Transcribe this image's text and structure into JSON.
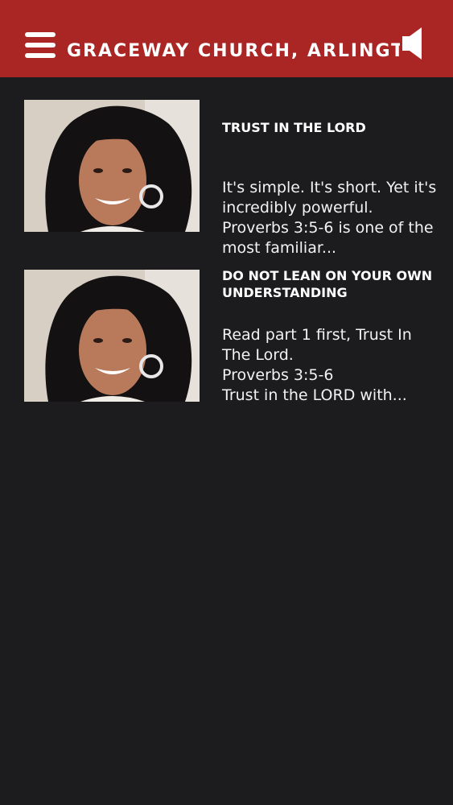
{
  "header": {
    "title": "GRACEWAY CHURCH, ARLINGTON",
    "menu_icon": "hamburger-menu-icon",
    "audio_icon": "speaker-icon",
    "accent_color": "#aa2624"
  },
  "background_color": "#1c1b1d",
  "posts": [
    {
      "title": "TRUST IN THE LORD",
      "excerpt": "It's simple. It's short. Yet it's incredibly powerful. Proverbs 3:5-6 is one of the most familiar..."
    },
    {
      "title": "DO NOT LEAN ON YOUR OWN UNDERSTANDING",
      "excerpt": "Read part 1 first, Trust In The Lord.\nProverbs 3:5-6\nTrust in the LORD with..."
    }
  ]
}
